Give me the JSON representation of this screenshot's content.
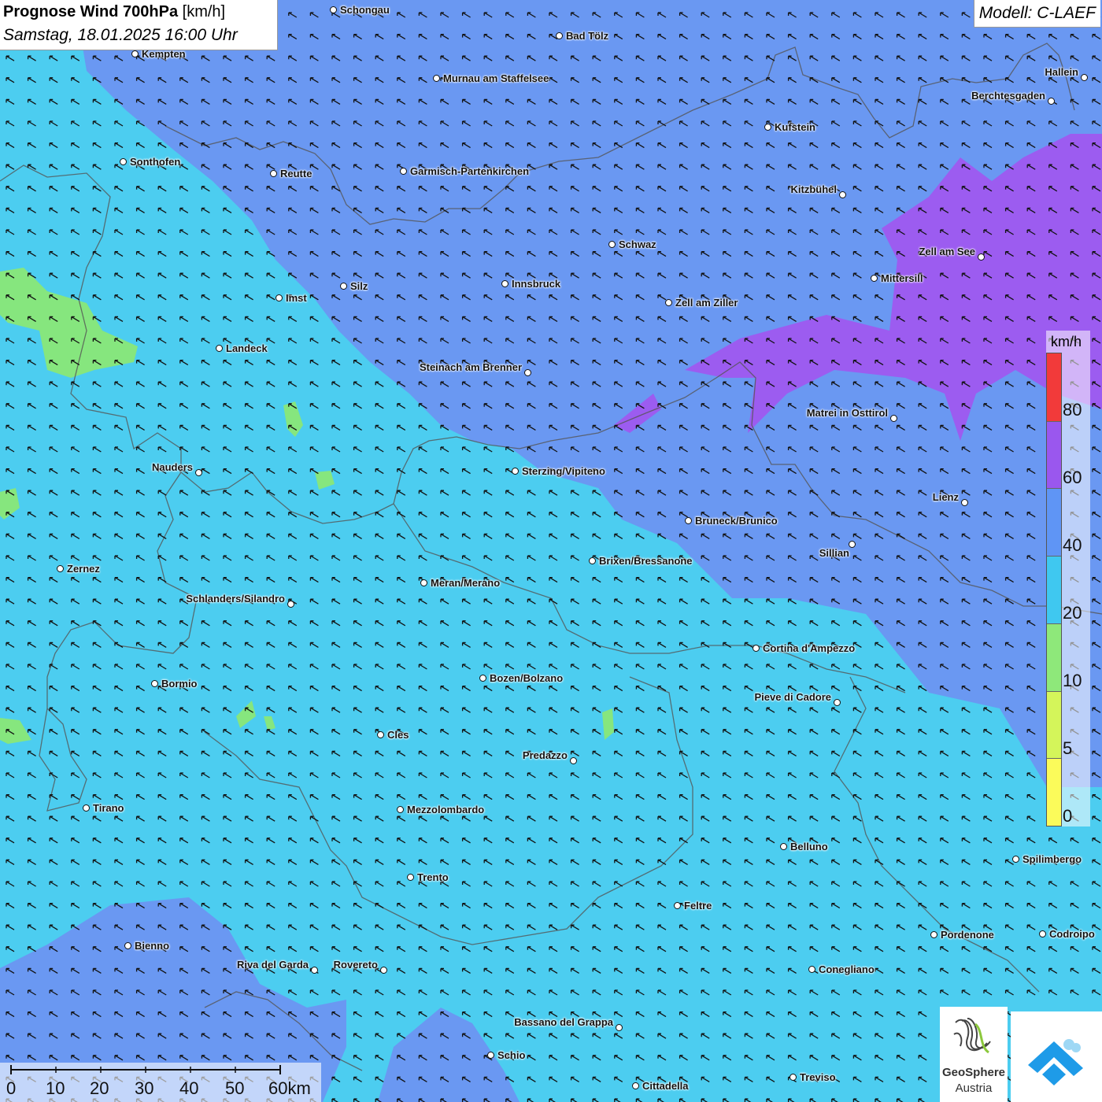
{
  "header": {
    "title_bold": "Prognose Wind 700hPa",
    "title_unit": "[km/h]",
    "datetime": "Samstag, 18.01.2025 16:00 Uhr"
  },
  "model": "Modell: C-LAEF",
  "legend": {
    "unit": "km/h",
    "ticks": [
      "0",
      "5",
      "10",
      "20",
      "40",
      "60",
      "80"
    ],
    "colors": [
      "#fbfb5a",
      "#d4f55a",
      "#8ee87a",
      "#3fc8f0",
      "#5f95f5",
      "#9a57ee",
      "#f23a3a"
    ]
  },
  "scalebar": {
    "labels": [
      "0",
      "10",
      "20",
      "30",
      "40",
      "50",
      "60km"
    ]
  },
  "wind_field": {
    "dominant_direction": "south-east",
    "background_color": "#4ccdf0",
    "arrow_color": "#111111"
  },
  "logos": {
    "geosphere_name": "GeoSphere",
    "geosphere_sub": "Austria"
  },
  "cities": [
    {
      "name": "Schongau"
    },
    {
      "name": "Bad Tölz"
    },
    {
      "name": "Kempten"
    },
    {
      "name": "Murnau am Staffelsee"
    },
    {
      "name": "Hallein"
    },
    {
      "name": "Berchtesgaden"
    },
    {
      "name": "Kufstein"
    },
    {
      "name": "Sonthofen"
    },
    {
      "name": "Reutte"
    },
    {
      "name": "Garmisch-Partenkirchen"
    },
    {
      "name": "Kitzbühel"
    },
    {
      "name": "Schwaz"
    },
    {
      "name": "Zell am See"
    },
    {
      "name": "Mittersill"
    },
    {
      "name": "Silz"
    },
    {
      "name": "Innsbruck"
    },
    {
      "name": "Imst"
    },
    {
      "name": "Zell am Ziller"
    },
    {
      "name": "Landeck"
    },
    {
      "name": "Steinach am Brenner"
    },
    {
      "name": "Matrei in Osttirol"
    },
    {
      "name": "Nauders"
    },
    {
      "name": "Sterzing/Vipiteno"
    },
    {
      "name": "Lienz"
    },
    {
      "name": "Bruneck/Brunico"
    },
    {
      "name": "Sillian"
    },
    {
      "name": "Zernez"
    },
    {
      "name": "Brixen/Bressanone"
    },
    {
      "name": "Meran/Merano"
    },
    {
      "name": "Schlanders/Silandro"
    },
    {
      "name": "Cortina d'Ampezzo"
    },
    {
      "name": "Bozen/Bolzano"
    },
    {
      "name": "Bormio"
    },
    {
      "name": "Pieve di Cadore"
    },
    {
      "name": "Cles"
    },
    {
      "name": "Predazzo"
    },
    {
      "name": "Tirano"
    },
    {
      "name": "Mezzolombardo"
    },
    {
      "name": "Belluno"
    },
    {
      "name": "Spilimbergo"
    },
    {
      "name": "Trento"
    },
    {
      "name": "Feltre"
    },
    {
      "name": "Pordenone"
    },
    {
      "name": "Codroipo"
    },
    {
      "name": "Bienno"
    },
    {
      "name": "Riva del Garda"
    },
    {
      "name": "Rovereto"
    },
    {
      "name": "Conegliano"
    },
    {
      "name": "Bassano del Grappa"
    },
    {
      "name": "Schio"
    },
    {
      "name": "Treviso"
    },
    {
      "name": "Cittadella"
    }
  ]
}
